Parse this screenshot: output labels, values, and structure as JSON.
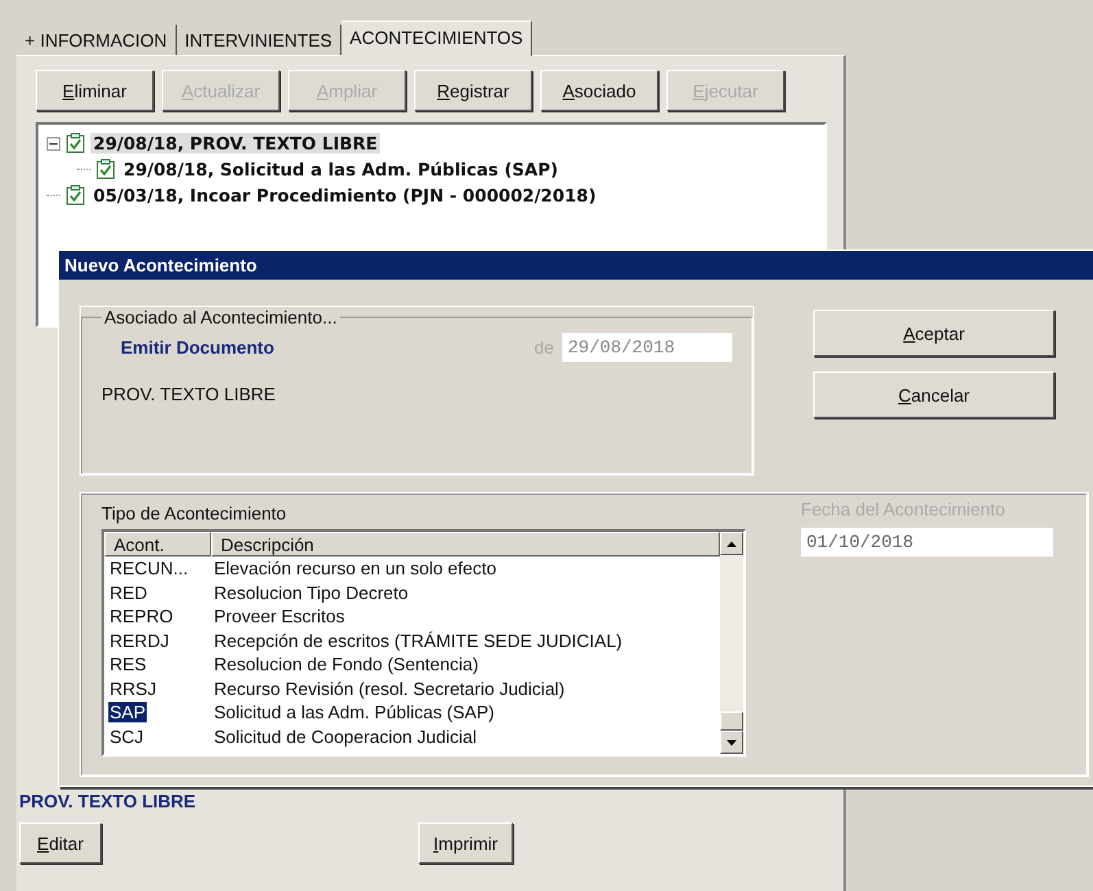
{
  "tabs": [
    {
      "label": "+ INFORMACION",
      "selected": false
    },
    {
      "label": "INTERVINIENTES",
      "selected": false
    },
    {
      "label": "ACONTECIMIENTOS",
      "selected": true
    }
  ],
  "toolbar": [
    {
      "label": "Eliminar",
      "disabled": false
    },
    {
      "label": "Actualizar",
      "disabled": true
    },
    {
      "label": "Ampliar",
      "disabled": true
    },
    {
      "label": "Registrar",
      "disabled": false
    },
    {
      "label": "Asociado",
      "disabled": false
    },
    {
      "label": "Ejecutar",
      "disabled": true
    }
  ],
  "tree": [
    {
      "label": "29/08/18,  PROV. TEXTO LIBRE",
      "checked": true,
      "selected": true,
      "expanded": true,
      "children": [
        {
          "label": "29/08/18, Solicitud a las Adm. Públicas (SAP)",
          "checked": true,
          "selected": false
        }
      ]
    },
    {
      "label": "05/03/18, Incoar Procedimiento (PJN - 000002/2018)",
      "checked": true,
      "selected": false
    }
  ],
  "dialog": {
    "title": "Nuevo Acontecimiento",
    "associated": {
      "legend": "Asociado al Acontecimiento...",
      "event": "Emitir Documento",
      "date_label": "de",
      "date": "29/08/2018",
      "description": "PROV. TEXTO LIBRE"
    },
    "buttons": [
      "Aceptar",
      "Cancelar"
    ],
    "type_group": {
      "legend": "Tipo de Acontecimiento",
      "columns": [
        "Acont.",
        "Descripción"
      ],
      "rows": [
        {
          "code": "RECUN...",
          "description": "Elevación recurso en un solo efecto",
          "selected": false
        },
        {
          "code": "RED",
          "description": "Resolucion Tipo Decreto",
          "selected": false
        },
        {
          "code": "REPRO",
          "description": "Proveer Escritos",
          "selected": false
        },
        {
          "code": "RERDJ",
          "description": "Recepción de escritos (TRÁMITE SEDE JUDICIAL)",
          "selected": false
        },
        {
          "code": "RES",
          "description": "Resolucion de Fondo (Sentencia)",
          "selected": false
        },
        {
          "code": "RRSJ",
          "description": "Recurso Revisión (resol. Secretario Judicial)",
          "selected": false
        },
        {
          "code": "SAP",
          "description": "Solicitud a las Adm. Públicas (SAP)",
          "selected": true
        },
        {
          "code": "SCJ",
          "description": "Solicitud de Cooperacion Judicial",
          "selected": false
        }
      ],
      "date_label": "Fecha del Acontecimiento",
      "date": "01/10/2018"
    }
  },
  "footer": {
    "title": "PROV. TEXTO LIBRE",
    "buttons": [
      "Editar",
      "Imprimir"
    ]
  }
}
